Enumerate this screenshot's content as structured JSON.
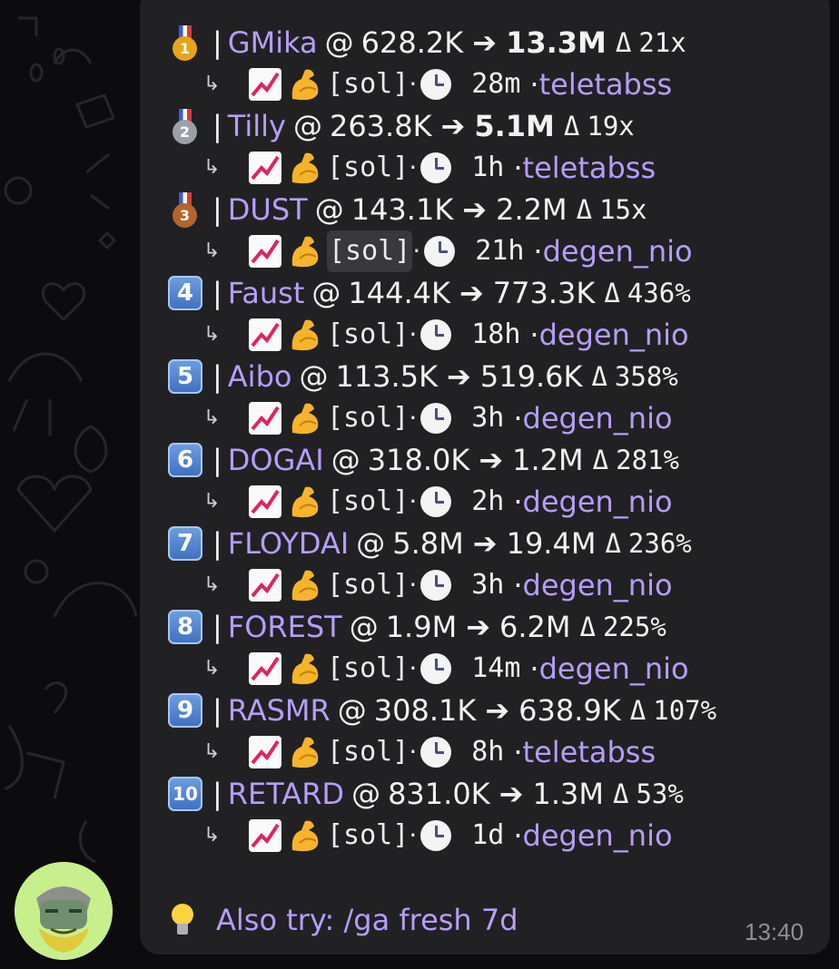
{
  "colors": {
    "background": "#0c0c0e",
    "bubble": "#212124",
    "accent_link": "#b79df7",
    "keycap": "#4a7fd0",
    "timestamp": "#8f8f95",
    "avatar_bg": "#c7f08c"
  },
  "entries": [
    {
      "rank_icon": "gold-medal-icon",
      "rank": "1",
      "name": "GMika",
      "at": "@",
      "mcap": "628.2K",
      "arrow": "➔",
      "target": "13.3M",
      "target_bold": true,
      "delta_sym": "Δ",
      "mult": "21x",
      "tag": "[sol]",
      "age": "28m",
      "source": "teletabss",
      "hl": false
    },
    {
      "rank_icon": "silver-medal-icon",
      "rank": "2",
      "name": "Tilly",
      "at": "@",
      "mcap": "263.8K",
      "arrow": "➔",
      "target": "5.1M",
      "target_bold": true,
      "delta_sym": "Δ",
      "mult": "19x",
      "tag": "[sol]",
      "age": "1h",
      "source": "teletabss",
      "hl": false
    },
    {
      "rank_icon": "bronze-medal-icon",
      "rank": "3",
      "name": "DUST",
      "at": "@",
      "mcap": "143.1K",
      "arrow": "➔",
      "target": "2.2M",
      "target_bold": false,
      "delta_sym": "Δ",
      "mult": "15x",
      "tag": "[sol]",
      "age": "21h",
      "source": "degen_nio",
      "hl": true
    },
    {
      "rank_icon": "keycap-4-icon",
      "rank": "4",
      "name": "Faust",
      "at": "@",
      "mcap": "144.4K",
      "arrow": "➔",
      "target": "773.3K",
      "target_bold": false,
      "delta_sym": "Δ",
      "mult": "436%",
      "tag": "[sol]",
      "age": "18h",
      "source": "degen_nio",
      "hl": false
    },
    {
      "rank_icon": "keycap-5-icon",
      "rank": "5",
      "name": "Aibo",
      "at": "@",
      "mcap": "113.5K",
      "arrow": "➔",
      "target": "519.6K",
      "target_bold": false,
      "delta_sym": "Δ",
      "mult": "358%",
      "tag": "[sol]",
      "age": "3h",
      "source": "degen_nio",
      "hl": false
    },
    {
      "rank_icon": "keycap-6-icon",
      "rank": "6",
      "name": "DOGAI",
      "at": "@",
      "mcap": "318.0K",
      "arrow": "➔",
      "target": "1.2M",
      "target_bold": false,
      "delta_sym": "Δ",
      "mult": "281%",
      "tag": "[sol]",
      "age": "2h",
      "source": "degen_nio",
      "hl": false
    },
    {
      "rank_icon": "keycap-7-icon",
      "rank": "7",
      "name": "FLOYDAI",
      "at": "@",
      "mcap": "5.8M",
      "arrow": "➔",
      "target": "19.4M",
      "target_bold": false,
      "delta_sym": "Δ",
      "mult": "236%",
      "tag": "[sol]",
      "age": "3h",
      "source": "degen_nio",
      "hl": false
    },
    {
      "rank_icon": "keycap-8-icon",
      "rank": "8",
      "name": "FOREST",
      "at": "@",
      "mcap": "1.9M",
      "arrow": "➔",
      "target": "6.2M",
      "target_bold": false,
      "delta_sym": "Δ",
      "mult": "225%",
      "tag": "[sol]",
      "age": "14m",
      "source": "degen_nio",
      "hl": false
    },
    {
      "rank_icon": "keycap-9-icon",
      "rank": "9",
      "name": "RASMR",
      "at": "@",
      "mcap": "308.1K",
      "arrow": "➔",
      "target": "638.9K",
      "target_bold": false,
      "delta_sym": "Δ",
      "mult": "107%",
      "tag": "[sol]",
      "age": "8h",
      "source": "teletabss",
      "hl": false
    },
    {
      "rank_icon": "keycap-10-icon",
      "rank": "10",
      "name": "RETARD",
      "at": "@",
      "mcap": "831.0K",
      "arrow": "➔",
      "target": "1.3M",
      "target_bold": false,
      "delta_sym": "Δ",
      "mult": "53%",
      "tag": "[sol]",
      "age": "1d",
      "source": "degen_nio",
      "hl": false
    }
  ],
  "sub_glyphs": {
    "hook": "↳",
    "sep": "|",
    "dot": "·"
  },
  "tip": {
    "icon": "light-bulb-icon",
    "text": "Also try: /ga fresh 7d"
  },
  "timestamp": "13:40",
  "avatar": {
    "icon": "bearded-character-avatar-icon"
  }
}
